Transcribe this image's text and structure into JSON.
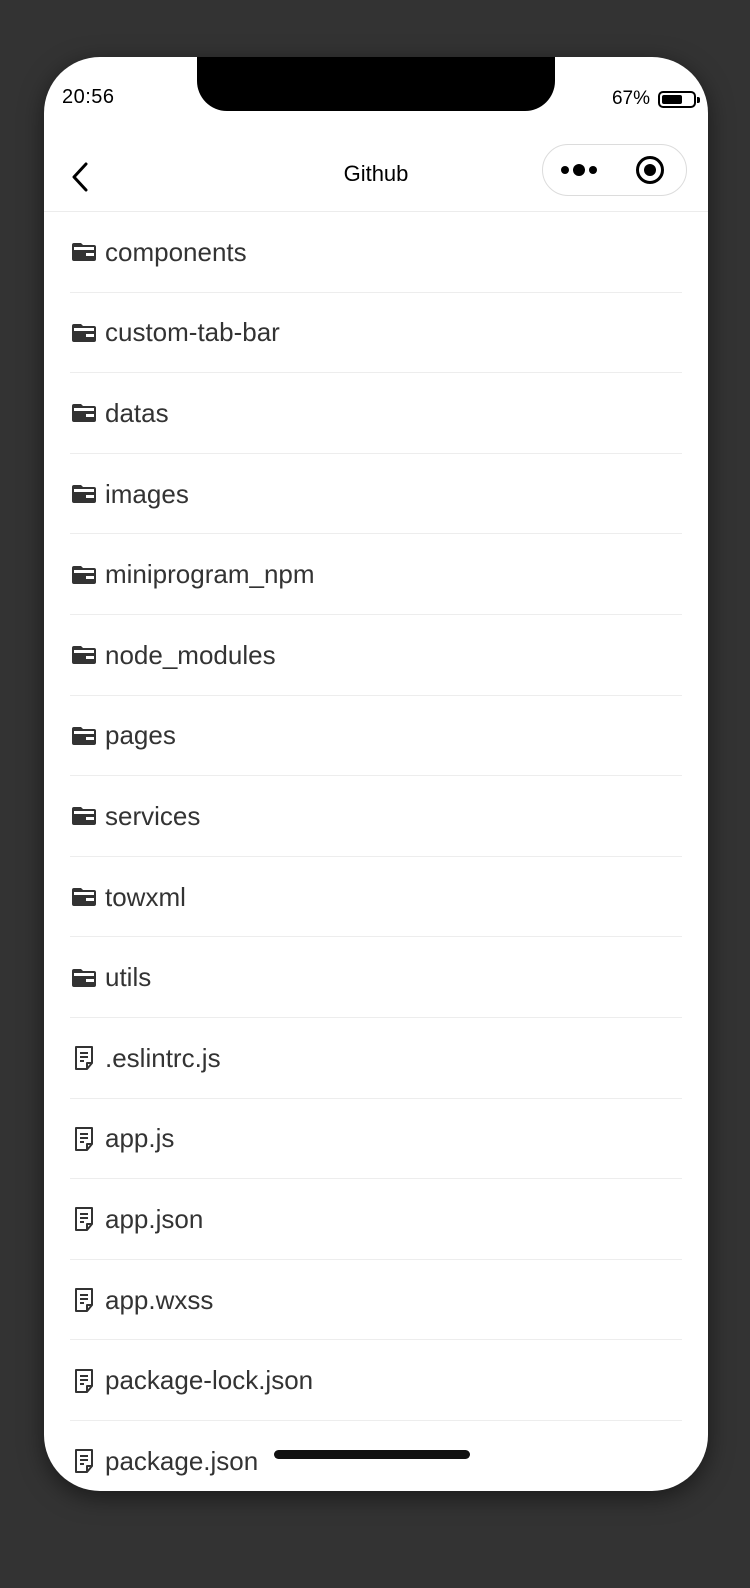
{
  "status_bar": {
    "time": "20:56",
    "battery_percent": "67%",
    "battery_level": 0.67
  },
  "nav": {
    "title": "Github",
    "back_icon": "chevron-left-icon",
    "menu_icon": "more-dots-icon",
    "close_icon": "target-circle-icon"
  },
  "files": [
    {
      "name": "components",
      "type": "folder"
    },
    {
      "name": "custom-tab-bar",
      "type": "folder"
    },
    {
      "name": "datas",
      "type": "folder"
    },
    {
      "name": "images",
      "type": "folder"
    },
    {
      "name": "miniprogram_npm",
      "type": "folder"
    },
    {
      "name": "node_modules",
      "type": "folder"
    },
    {
      "name": "pages",
      "type": "folder"
    },
    {
      "name": "services",
      "type": "folder"
    },
    {
      "name": "towxml",
      "type": "folder"
    },
    {
      "name": "utils",
      "type": "folder"
    },
    {
      "name": ".eslintrc.js",
      "type": "file"
    },
    {
      "name": "app.js",
      "type": "file"
    },
    {
      "name": "app.json",
      "type": "file"
    },
    {
      "name": "app.wxss",
      "type": "file"
    },
    {
      "name": "package-lock.json",
      "type": "file"
    },
    {
      "name": "package.json",
      "type": "file"
    }
  ],
  "colors": {
    "background": "#333333",
    "surface": "#ffffff",
    "text": "#333333",
    "divider": "#ededed"
  }
}
